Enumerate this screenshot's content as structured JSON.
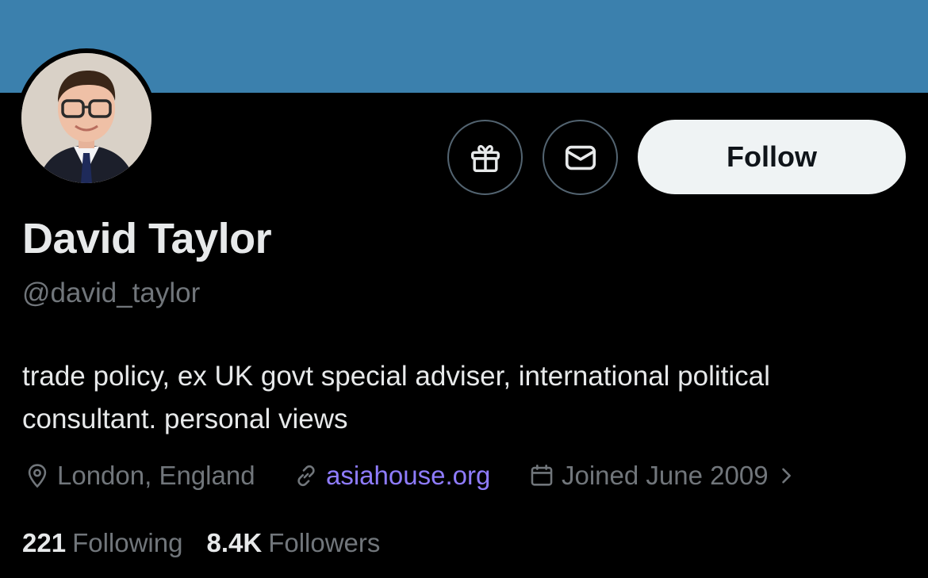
{
  "profile": {
    "display_name": "David Taylor",
    "handle": "@david_taylor",
    "bio": "trade policy, ex UK govt special adviser, international political consultant. personal views",
    "location": "London, England",
    "website": "asiahouse.org",
    "joined": "Joined June 2009"
  },
  "actions": {
    "follow_label": "Follow",
    "gift_icon": "gift-icon",
    "message_icon": "envelope-icon"
  },
  "stats": {
    "following_count": "221",
    "following_label": "Following",
    "followers_count": "8.4K",
    "followers_label": "Followers"
  },
  "colors": {
    "banner": "#3b80ad",
    "background": "#000000",
    "link": "#8f7cff",
    "follow_button": "#eff3f4"
  }
}
